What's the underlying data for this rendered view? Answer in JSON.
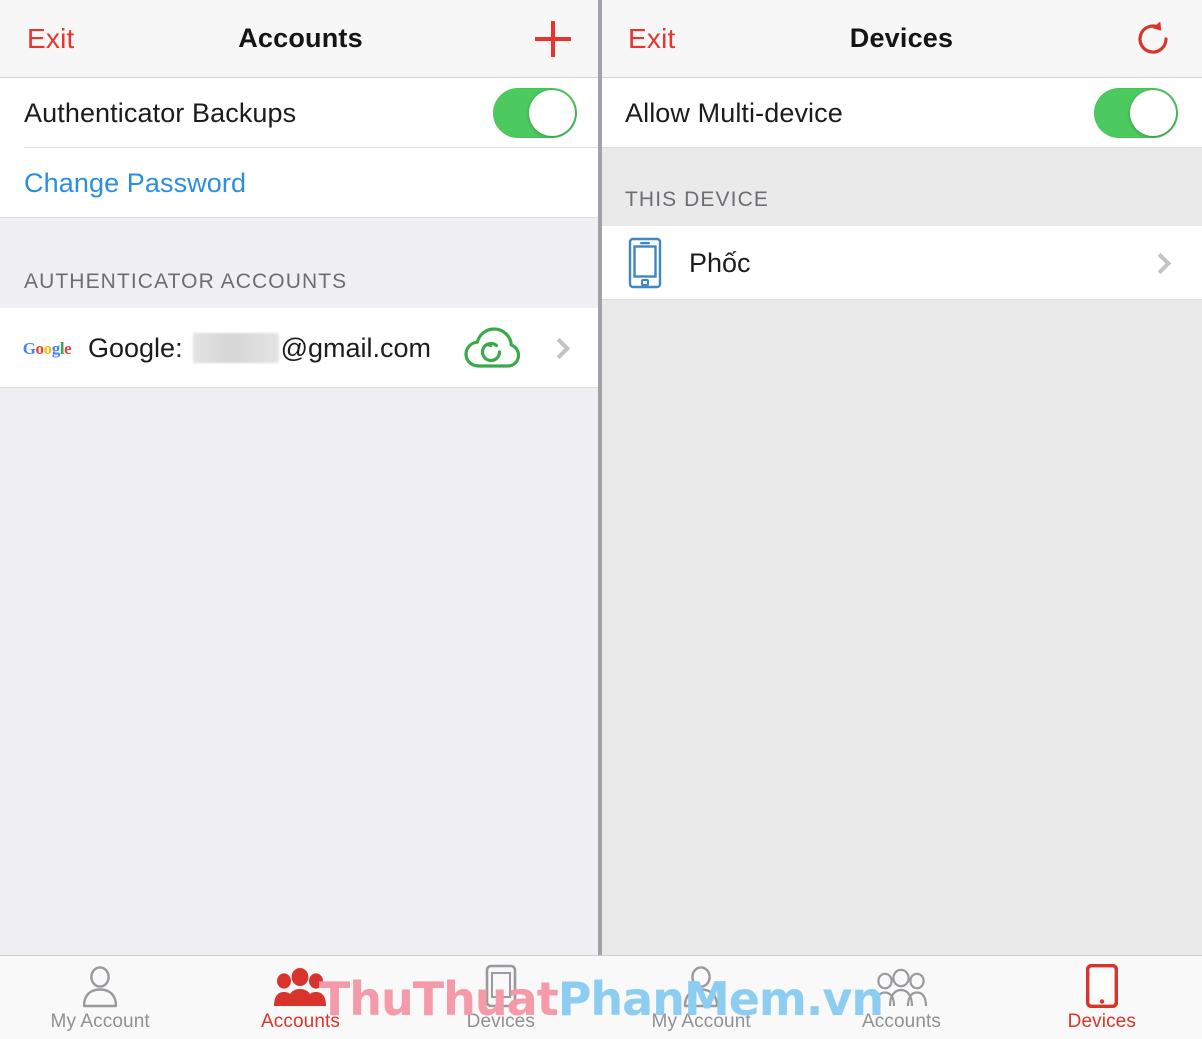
{
  "watermark": {
    "part1": "ThuThuat",
    "part2": "PhanMem.vn",
    "color1": "#f49aa8",
    "color2": "#8ecdf2"
  },
  "colors": {
    "accent_red": "#e8342c",
    "toggle_green": "#4cc95f",
    "link_blue": "#2a8fe0",
    "cloud_green": "#3aa94a",
    "device_blue": "#3f86c4",
    "panel_bg_left": "#efeff4",
    "panel_bg_right": "#eaeaea"
  },
  "left_panel": {
    "navbar": {
      "left_button": "Exit",
      "title": "Accounts",
      "right_icon": "plus-icon"
    },
    "rows": [
      {
        "label": "Authenticator Backups",
        "type": "toggle",
        "toggle_on": true
      },
      {
        "label": "Change Password",
        "type": "link"
      }
    ],
    "section_header": "AUTHENTICATOR ACCOUNTS",
    "account": {
      "provider_icon": "google-logo-icon",
      "prefix": "Google:",
      "redacted": true,
      "suffix": "@gmail.com",
      "status_icon": "cloud-restore-icon",
      "chevron": "chevron-right-icon"
    },
    "tabs": [
      {
        "label": "My Account",
        "icon": "person-outline-icon",
        "active": false
      },
      {
        "label": "Accounts",
        "icon": "people-filled-icon",
        "active": true
      },
      {
        "label": "Devices",
        "icon": "phone-outline-icon",
        "active": false
      }
    ]
  },
  "right_panel": {
    "navbar": {
      "left_button": "Exit",
      "title": "Devices",
      "right_icon": "refresh-icon"
    },
    "rows": [
      {
        "label": "Allow Multi-device",
        "type": "toggle",
        "toggle_on": true
      }
    ],
    "section_header": "THIS DEVICE",
    "device": {
      "name": "Phốc",
      "icon": "smartphone-outline-icon",
      "chevron": "chevron-right-icon"
    },
    "tabs": [
      {
        "label": "My Account",
        "icon": "person-outline-icon",
        "active": false
      },
      {
        "label": "Accounts",
        "icon": "people-outline-icon",
        "active": false
      },
      {
        "label": "Devices",
        "icon": "phone-filled-icon",
        "active": true
      }
    ]
  }
}
